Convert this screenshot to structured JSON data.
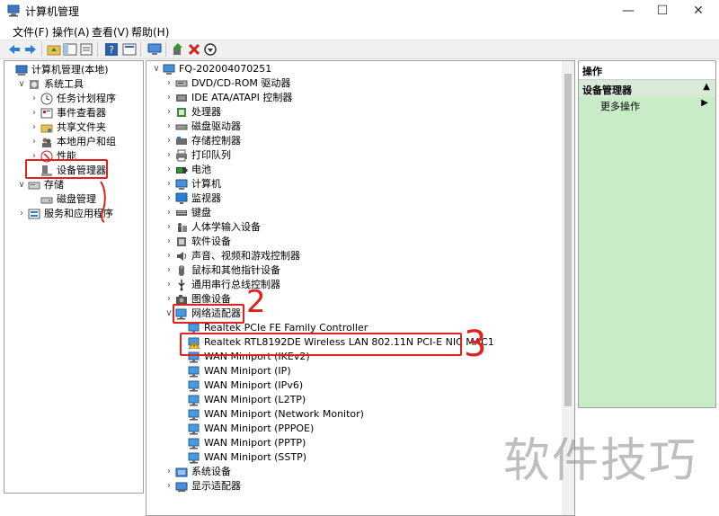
{
  "window": {
    "title": "计算机管理"
  },
  "menu": [
    "文件(F)",
    "操作(A)",
    "查看(V)",
    "帮助(H)"
  ],
  "left_tree": [
    {
      "label": "计算机管理(本地)",
      "indent": 0,
      "expander": "",
      "icon": "computer-management-icon"
    },
    {
      "label": "系统工具",
      "indent": 1,
      "expander": "down",
      "icon": "system-tools-icon"
    },
    {
      "label": "任务计划程序",
      "indent": 2,
      "expander": "right",
      "icon": "task-scheduler-icon"
    },
    {
      "label": "事件查看器",
      "indent": 2,
      "expander": "right",
      "icon": "event-viewer-icon"
    },
    {
      "label": "共享文件夹",
      "indent": 2,
      "expander": "right",
      "icon": "shared-folder-icon"
    },
    {
      "label": "本地用户和组",
      "indent": 2,
      "expander": "right",
      "icon": "users-icon"
    },
    {
      "label": "性能",
      "indent": 2,
      "expander": "right",
      "icon": "performance-icon"
    },
    {
      "label": "设备管理器",
      "indent": 2,
      "expander": "",
      "icon": "device-manager-icon"
    },
    {
      "label": "存储",
      "indent": 1,
      "expander": "down",
      "icon": "storage-icon"
    },
    {
      "label": "磁盘管理",
      "indent": 2,
      "expander": "",
      "icon": "disk-management-icon"
    },
    {
      "label": "服务和应用程序",
      "indent": 1,
      "expander": "right",
      "icon": "services-icon"
    }
  ],
  "device_tree": [
    {
      "label": "FQ-202004070251",
      "indent": 0,
      "expander": "down",
      "icon": "computer-icon"
    },
    {
      "label": "DVD/CD-ROM 驱动器",
      "indent": 1,
      "expander": "right",
      "icon": "dvd-drive-icon"
    },
    {
      "label": "IDE ATA/ATAPI 控制器",
      "indent": 1,
      "expander": "right",
      "icon": "ide-controller-icon"
    },
    {
      "label": "处理器",
      "indent": 1,
      "expander": "right",
      "icon": "processor-icon"
    },
    {
      "label": "磁盘驱动器",
      "indent": 1,
      "expander": "right",
      "icon": "disk-drive-icon"
    },
    {
      "label": "存储控制器",
      "indent": 1,
      "expander": "right",
      "icon": "storage-controller-icon"
    },
    {
      "label": "打印队列",
      "indent": 1,
      "expander": "right",
      "icon": "printer-icon"
    },
    {
      "label": "电池",
      "indent": 1,
      "expander": "right",
      "icon": "battery-icon"
    },
    {
      "label": "计算机",
      "indent": 1,
      "expander": "right",
      "icon": "computer-icon"
    },
    {
      "label": "监视器",
      "indent": 1,
      "expander": "right",
      "icon": "monitor-icon"
    },
    {
      "label": "键盘",
      "indent": 1,
      "expander": "right",
      "icon": "keyboard-icon"
    },
    {
      "label": "人体学输入设备",
      "indent": 1,
      "expander": "right",
      "icon": "hid-icon"
    },
    {
      "label": "软件设备",
      "indent": 1,
      "expander": "right",
      "icon": "software-device-icon"
    },
    {
      "label": "声音、视频和游戏控制器",
      "indent": 1,
      "expander": "right",
      "icon": "sound-icon"
    },
    {
      "label": "鼠标和其他指针设备",
      "indent": 1,
      "expander": "right",
      "icon": "mouse-icon"
    },
    {
      "label": "通用串行总线控制器",
      "indent": 1,
      "expander": "right",
      "icon": "usb-icon"
    },
    {
      "label": "图像设备",
      "indent": 1,
      "expander": "right",
      "icon": "camera-icon"
    },
    {
      "label": "网络适配器",
      "indent": 1,
      "expander": "down",
      "icon": "network-adapter-icon"
    },
    {
      "label": "Realtek PCIe FE Family Controller",
      "indent": 2,
      "expander": "",
      "icon": "network-adapter-icon"
    },
    {
      "label": "Realtek RTL8192DE Wireless LAN 802.11N PCI-E NIC MAC1",
      "indent": 2,
      "expander": "",
      "icon": "network-adapter-warning-icon"
    },
    {
      "label": "WAN Miniport (IKEv2)",
      "indent": 2,
      "expander": "",
      "icon": "network-adapter-icon"
    },
    {
      "label": "WAN Miniport (IP)",
      "indent": 2,
      "expander": "",
      "icon": "network-adapter-icon"
    },
    {
      "label": "WAN Miniport (IPv6)",
      "indent": 2,
      "expander": "",
      "icon": "network-adapter-icon"
    },
    {
      "label": "WAN Miniport (L2TP)",
      "indent": 2,
      "expander": "",
      "icon": "network-adapter-icon"
    },
    {
      "label": "WAN Miniport (Network Monitor)",
      "indent": 2,
      "expander": "",
      "icon": "network-adapter-icon"
    },
    {
      "label": "WAN Miniport (PPPOE)",
      "indent": 2,
      "expander": "",
      "icon": "network-adapter-icon"
    },
    {
      "label": "WAN Miniport (PPTP)",
      "indent": 2,
      "expander": "",
      "icon": "network-adapter-icon"
    },
    {
      "label": "WAN Miniport (SSTP)",
      "indent": 2,
      "expander": "",
      "icon": "network-adapter-icon"
    },
    {
      "label": "系统设备",
      "indent": 1,
      "expander": "right",
      "icon": "system-device-icon"
    },
    {
      "label": "显示适配器",
      "indent": 1,
      "expander": "right",
      "icon": "display-adapter-icon"
    }
  ],
  "actions": {
    "header": "操作",
    "section": "设备管理器",
    "more": "更多操作"
  },
  "annotations": {
    "two": "2",
    "three": "3"
  },
  "watermark": "软件技巧",
  "colors": {
    "annotation_red": "#e0211d",
    "actions_green": "#c8ecc8"
  }
}
